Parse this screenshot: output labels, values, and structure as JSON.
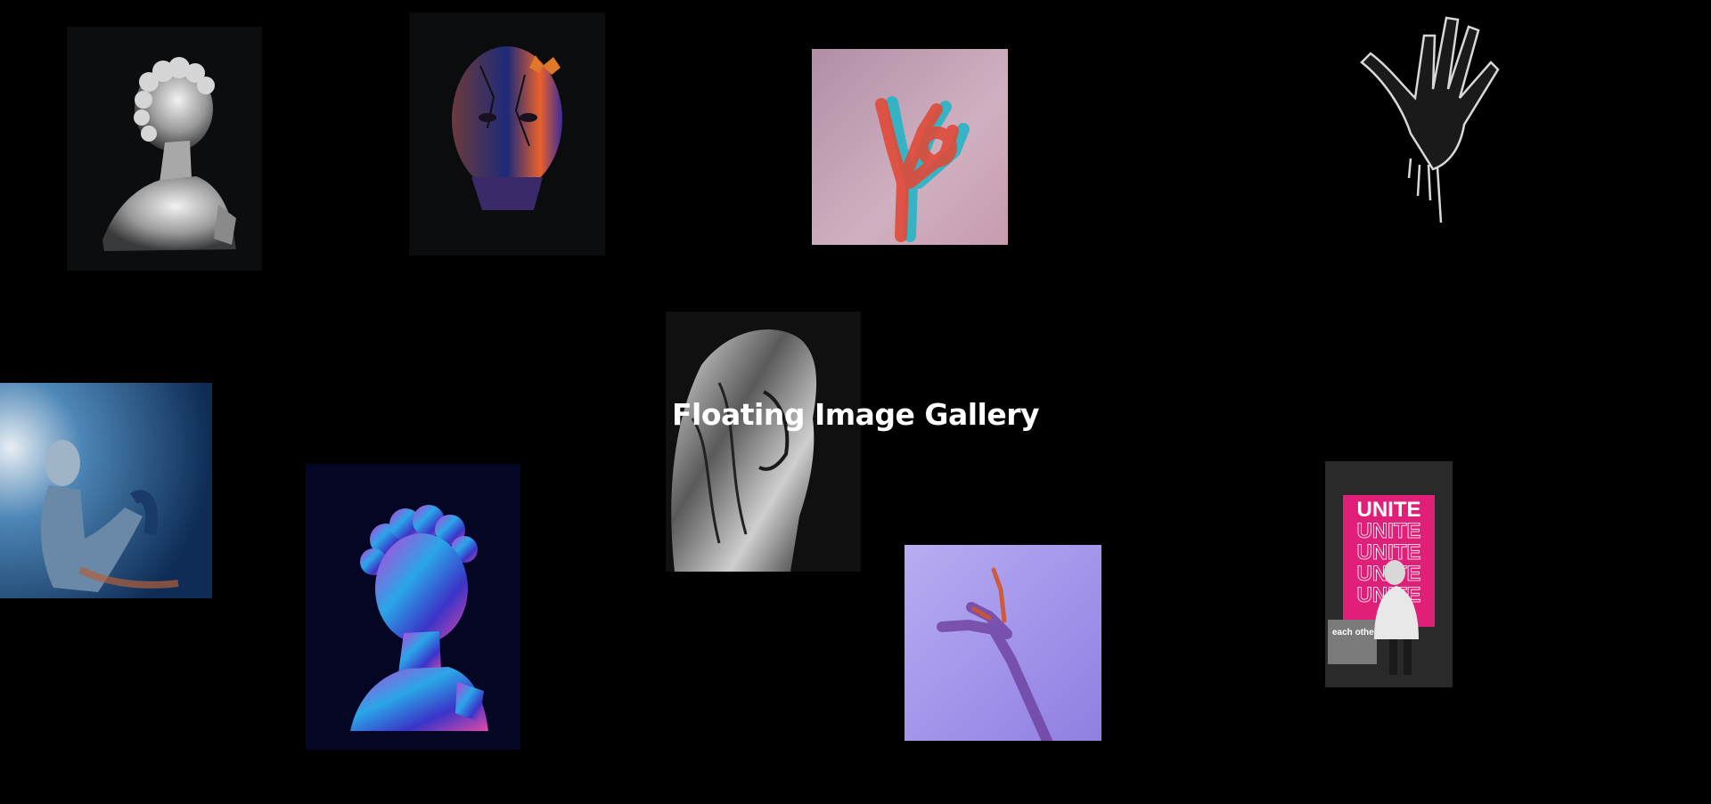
{
  "page": {
    "title": "Floating Image Gallery",
    "background": "#000000"
  },
  "gallery": {
    "images": [
      {
        "name": "marble-david-bust-image",
        "subject": "marble bust",
        "palette": [
          "#0c0d0f",
          "#cfcfcf"
        ]
      },
      {
        "name": "cracked-head-butterfly-image",
        "subject": "cracked head with butterfly",
        "palette": [
          "#0b0c0e",
          "#e85a2c",
          "#2e3fbf"
        ]
      },
      {
        "name": "anaglyph-hand-pink-image",
        "subject": "hand on pink",
        "palette": [
          "#c9a6ba",
          "#e84a3a",
          "#2bb8c8"
        ]
      },
      {
        "name": "liquid-chrome-hand-image",
        "subject": "chrome hand",
        "palette": [
          "#000000",
          "#d8d8d8"
        ]
      },
      {
        "name": "blue-figure-statue-image",
        "subject": "statue in blue light",
        "palette": [
          "#0d2c52",
          "#9ec4de",
          "#b0603c"
        ]
      },
      {
        "name": "holographic-david-bust-image",
        "subject": "holographic bust",
        "palette": [
          "#050524",
          "#2aa6e8",
          "#c839d8"
        ]
      },
      {
        "name": "chrome-veiled-figure-image",
        "subject": "veiled chrome figure",
        "palette": [
          "#101010",
          "#bdbdbd"
        ]
      },
      {
        "name": "blurred-hand-purple-image",
        "subject": "hand on lavender",
        "palette": [
          "#9f92e8",
          "#c2b6f4",
          "#d2542a"
        ]
      },
      {
        "name": "unite-poster-image",
        "subject": "poster",
        "palette": [
          "#2a2a2a",
          "#e01f78"
        ],
        "poster_words": [
          "UNITE",
          "UNITE",
          "UNITE",
          "UNITE",
          "UNITE"
        ],
        "poster_caption": "each other"
      }
    ]
  }
}
